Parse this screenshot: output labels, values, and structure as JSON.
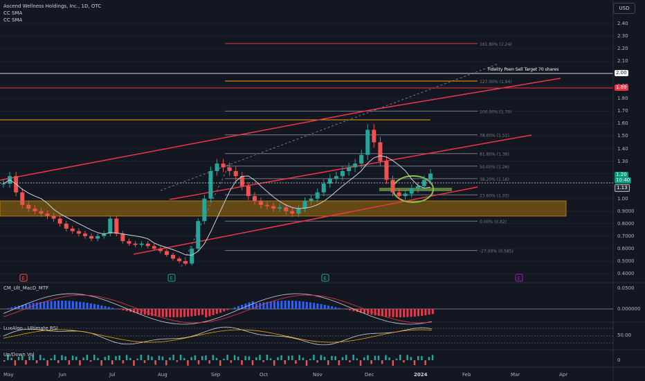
{
  "header": {
    "title": "Ascend Wellness Holdings, Inc., 1D, OTC",
    "indicators": [
      "CC SMA",
      "CC SMA"
    ]
  },
  "currency_button": "USD",
  "price_axis": [
    "2.40",
    "2.30",
    "2.20",
    "2.10",
    "2.00",
    "1.90",
    "1.80",
    "1.70",
    "1.60",
    "1.50",
    "1.40",
    "1.30",
    "1.20",
    "1.10",
    "1.00",
    "0.9000",
    "0.8000",
    "0.7000",
    "0.6000",
    "0.5000",
    "0.4000"
  ],
  "price_tags": {
    "target": "2.00",
    "red": "1.89",
    "current": "1.20",
    "countdown": "10:40",
    "prev": "1.13"
  },
  "annotation": "Fidelity Poen Sell Target 70 shares",
  "fib_levels": [
    {
      "label": "161.80% (2.24)",
      "price": 2.24
    },
    {
      "label": "127.00% (1.94)",
      "price": 1.94
    },
    {
      "label": "100.00% (1.70)",
      "price": 1.7
    },
    {
      "label": "78.60% (1.51)",
      "price": 1.51
    },
    {
      "label": "61.80% (1.36)",
      "price": 1.36
    },
    {
      "label": "50.00% (1.26)",
      "price": 1.26
    },
    {
      "label": "38.20% (1.16)",
      "price": 1.16
    },
    {
      "label": "23.60% (1.03)",
      "price": 1.03
    },
    {
      "label": "0.00% (0.82)",
      "price": 0.82
    },
    {
      "label": "-27.00% (0.585)",
      "price": 0.585
    }
  ],
  "panes": {
    "macd": {
      "title": "CM_Ult_MacD_MTF",
      "axis": [
        "0.0500",
        "0.000000"
      ]
    },
    "rsi": {
      "title": "LuxAlgo - Ultimate RSI",
      "axis": [
        "50.00"
      ]
    },
    "vol": {
      "title": "Up/Down Vol",
      "axis": [
        "0"
      ]
    }
  },
  "time_axis": [
    "May",
    "Jun",
    "Jul",
    "Aug",
    "Sep",
    "Oct",
    "Nov",
    "Dec",
    "2024",
    "Feb",
    "Mar",
    "Apr"
  ],
  "earnings_markers": [
    "E",
    "E",
    "E",
    "E"
  ],
  "colors": {
    "background": "#131722",
    "up": "#26a69a",
    "down": "#ef5350",
    "channel": "#f23645",
    "zone": "#f7a600"
  },
  "chart_data": {
    "type": "candlestick",
    "price_range": [
      0.4,
      2.4
    ],
    "close": [
      1.12,
      1.18,
      1.05,
      0.95,
      0.92,
      0.9,
      0.88,
      0.86,
      0.84,
      0.8,
      0.76,
      0.74,
      0.72,
      0.7,
      0.68,
      0.7,
      0.72,
      0.84,
      0.72,
      0.66,
      0.64,
      0.63,
      0.64,
      0.62,
      0.6,
      0.58,
      0.55,
      0.52,
      0.5,
      0.48,
      0.6,
      0.82,
      1.0,
      1.22,
      1.28,
      1.25,
      1.22,
      1.18,
      1.1,
      1.02,
      0.98,
      0.95,
      0.94,
      0.92,
      0.93,
      0.9,
      0.88,
      0.92,
      0.98,
      1.0,
      1.05,
      1.12,
      1.16,
      1.18,
      1.22,
      1.25,
      1.28,
      1.35,
      1.55,
      1.45,
      1.3,
      1.15,
      1.05,
      1.02,
      1.04,
      1.08,
      1.1,
      1.15,
      1.2
    ]
  }
}
